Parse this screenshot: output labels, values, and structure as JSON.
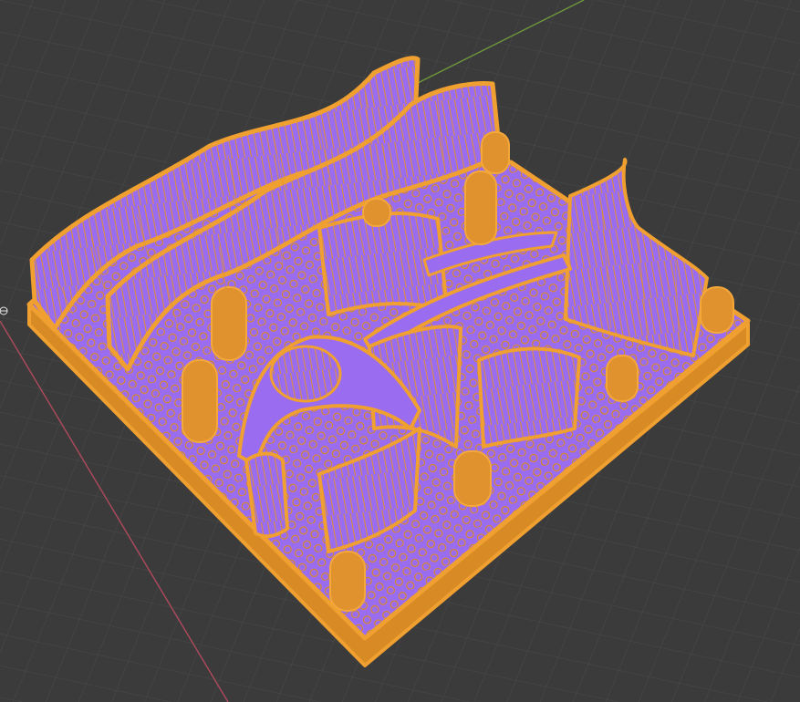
{
  "viewport": {
    "background_color": "#3b3b3b",
    "grid_color": "#4a4a4a",
    "x_axis_color": "#b04a5e",
    "y_axis_color": "#6f9a3a"
  },
  "model": {
    "selection_outline_color": "#f0a030",
    "face_color": "#9a6cf0",
    "wire_color": "#e0922e",
    "base_shadow_color": "#d88a25"
  },
  "origin_marker": {
    "icon": "origin-marker-icon"
  }
}
